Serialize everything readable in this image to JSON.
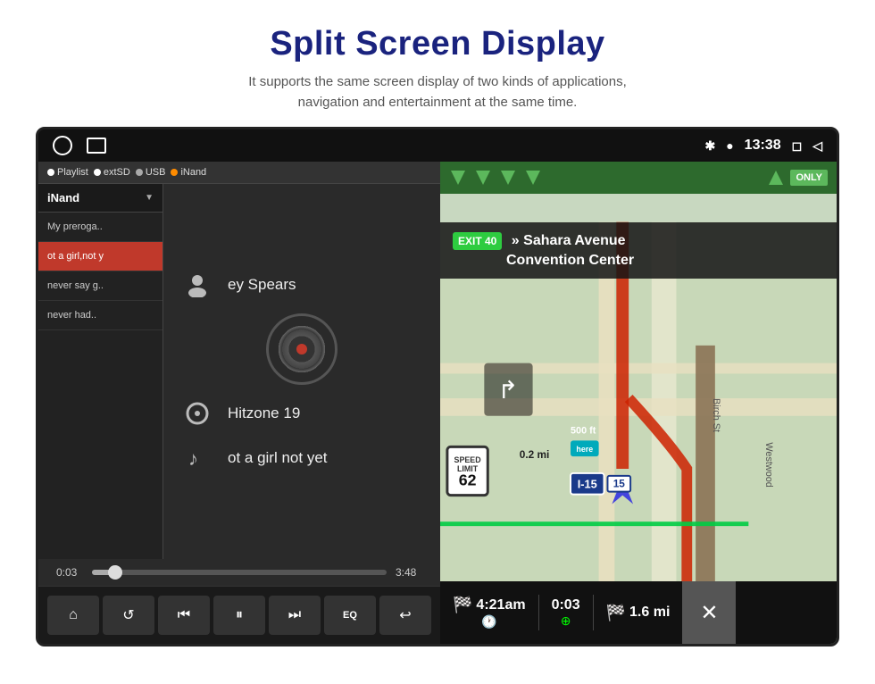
{
  "header": {
    "title": "Split Screen Display",
    "subtitle": "It supports the same screen display of two kinds of applications,\nnavigation and entertainment at the same time."
  },
  "status_bar": {
    "time": "13:38",
    "icons": [
      "bluetooth",
      "location",
      "window",
      "back"
    ]
  },
  "music": {
    "source_header": "iNand",
    "sources": [
      "Playlist",
      "extSD",
      "USB",
      "iNand"
    ],
    "playlist": [
      {
        "text": "My preroga..",
        "active": false
      },
      {
        "text": "ot a girl,not y",
        "active": true
      },
      {
        "text": "never say g..",
        "active": false
      },
      {
        "text": "never had..",
        "active": false
      }
    ],
    "artist": "ey Spears",
    "album": "Hitzone 19",
    "song": "ot a girl not yet",
    "time_current": "0:03",
    "time_total": "3:48",
    "controls": [
      "home",
      "repeat",
      "prev",
      "pause",
      "next",
      "eq",
      "back"
    ]
  },
  "navigation": {
    "highway_sign": {
      "road": "I-15",
      "direction_arrows": 4,
      "only_label": "ONLY"
    },
    "exit_banner": {
      "exit_label": "EXIT 40",
      "street": "Sahara Avenue",
      "venue": "Convention Center"
    },
    "speed_limit": "62",
    "distance": "0.2 mi",
    "interstate": "I-15",
    "interstate_num": "15",
    "bottom": {
      "eta": "4:21am",
      "duration": "0:03",
      "distance": "1.6 mi"
    }
  },
  "controls": {
    "home_label": "⌂",
    "repeat_label": "↺",
    "prev_label": "⏮",
    "pause_label": "⏸",
    "next_label": "⏭",
    "eq_label": "EQ",
    "back_label": "↩",
    "close_label": "✕"
  }
}
